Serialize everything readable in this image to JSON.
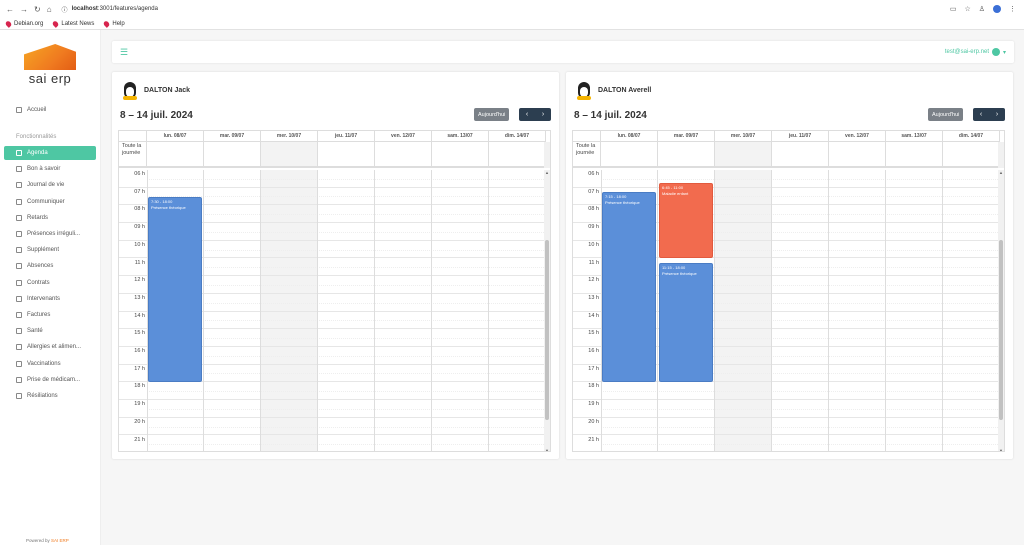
{
  "browser": {
    "url_host": "localhost",
    "url_rest": ":3001/features/agenda",
    "bookmarks": [
      "Debian.org",
      "Latest News",
      "Help"
    ]
  },
  "sidebar": {
    "logo_text": "sai erp",
    "home": "Accueil",
    "section": "Fonctionnalités",
    "items": [
      "Agenda",
      "Bon à savoir",
      "Journal de vie",
      "Communiquer",
      "Retards",
      "Présences irréguli...",
      "Supplément",
      "Absences",
      "Contrats",
      "Intervenants",
      "Factures",
      "Santé",
      "Allergies et alimen...",
      "Vaccinations",
      "Prise de médicam...",
      "Résiliations"
    ],
    "powered_prefix": "Powered by",
    "powered_brand": "SAI ERP"
  },
  "topbar": {
    "user_email": "test@sai-erp.net"
  },
  "calendar_common": {
    "range": "8 – 14 juil. 2024",
    "today_label": "Aujourd'hui",
    "prev": "‹",
    "next": "›",
    "days": [
      "lun. 08/07",
      "mar. 09/07",
      "mer. 10/07",
      "jeu. 11/07",
      "ven. 12/07",
      "sam. 13/07",
      "dim. 14/07"
    ],
    "allday_label": "Toute la journée",
    "hours": [
      "06 h",
      "07 h",
      "08 h",
      "09 h",
      "10 h",
      "11 h",
      "12 h",
      "13 h",
      "14 h",
      "15 h",
      "16 h",
      "17 h",
      "18 h",
      "19 h",
      "20 h",
      "21 h"
    ]
  },
  "panels": [
    {
      "name": "DALTON Jack",
      "events": [
        {
          "day": 0,
          "start": 7.5,
          "end": 18.0,
          "time": "7:30 - 18:00",
          "title": "Présence théorique",
          "color": "blue"
        }
      ]
    },
    {
      "name": "DALTON Averell",
      "events": [
        {
          "day": 0,
          "start": 7.25,
          "end": 18.0,
          "time": "7:15 - 18:00",
          "title": "Présence théorique",
          "color": "blue"
        },
        {
          "day": 1,
          "start": 6.75,
          "end": 11.0,
          "time": "6:45 - 11:00",
          "title": "Maladie enfant",
          "color": "red"
        },
        {
          "day": 1,
          "start": 11.25,
          "end": 18.0,
          "time": "11:15 - 18:00",
          "title": "Présence théorique",
          "color": "blue"
        }
      ]
    }
  ]
}
